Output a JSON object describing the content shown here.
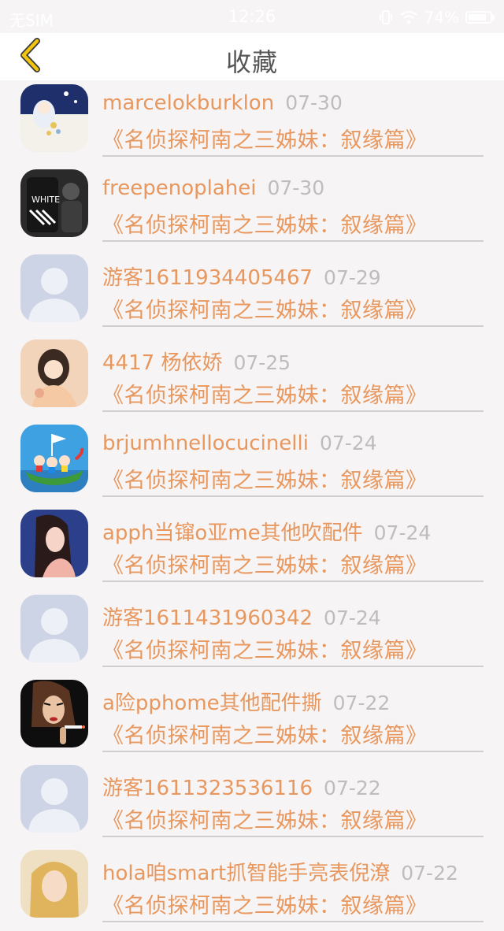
{
  "status_bar": {
    "carrier": "无SIM",
    "time": "12:26",
    "battery": "74%"
  },
  "nav": {
    "title": "收藏",
    "back_icon": "chevron-left-icon"
  },
  "colors": {
    "accent": "#e8975e",
    "date": "#bdbdbd",
    "back": "#f2c40f"
  },
  "items": [
    {
      "name": "marcelokburklon",
      "date": "07-30",
      "book": "《名侦探柯南之三姊妹：叙缘篇》",
      "avatar": "anime-girl"
    },
    {
      "name": "freepenoplahei",
      "date": "07-30",
      "book": "《名侦探柯南之三姊妹：叙缘篇》",
      "avatar": "offwhite"
    },
    {
      "name": "游客1611934405467",
      "date": "07-29",
      "book": "《名侦探柯南之三姊妹：叙缘篇》",
      "avatar": "default"
    },
    {
      "name": "4417 杨依娇",
      "date": "07-25",
      "book": "《名侦探柯南之三姊妹：叙缘篇》",
      "avatar": "girl-photo"
    },
    {
      "name": "brjumhnellocucinelli",
      "date": "07-24",
      "book": "《名侦探柯南之三姊妹：叙缘篇》",
      "avatar": "cartoon-boat"
    },
    {
      "name": "apph当镩o亚me其他吹配件",
      "date": "07-24",
      "book": "《名侦探柯南之三姊妹：叙缘篇》",
      "avatar": "illustration-girl"
    },
    {
      "name": "游客1611431960342",
      "date": "07-24",
      "book": "《名侦探柯南之三姊妹：叙缘篇》",
      "avatar": "default"
    },
    {
      "name": "a险pphome其他配件撕",
      "date": "07-22",
      "book": "《名侦探柯南之三姊妹：叙缘篇》",
      "avatar": "smoking-woman"
    },
    {
      "name": "游客1611323536116",
      "date": "07-22",
      "book": "《名侦探柯南之三姊妹：叙缘篇》",
      "avatar": "default"
    },
    {
      "name": "hola咱smart抓智能手亮表倪潦",
      "date": "07-22",
      "book": "《名侦探柯南之三姊妹：叙缘篇》",
      "avatar": "blonde-girl"
    }
  ]
}
